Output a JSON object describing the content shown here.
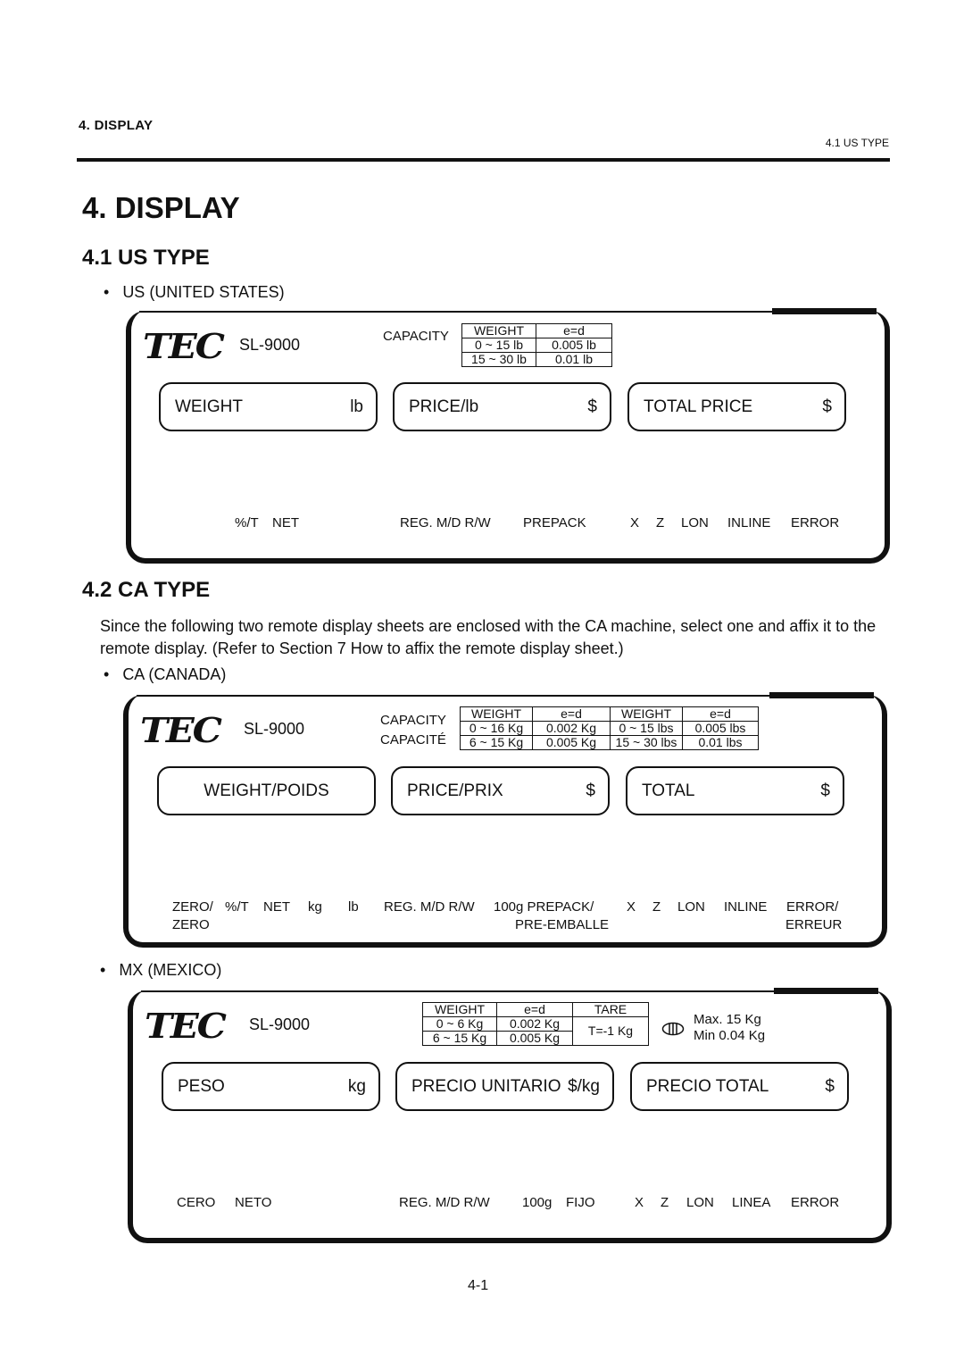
{
  "header": {
    "section": "4.  DISPLAY",
    "subsection": "4.1 US TYPE"
  },
  "title": "4. DISPLAY",
  "us": {
    "heading": "4.1  US TYPE",
    "bullet": "US (UNITED STATES)",
    "logo": "TEC",
    "model": "SL-9000",
    "capacity_label": "CAPACITY",
    "table": [
      [
        "WEIGHT",
        "e=d"
      ],
      [
        "0 ~ 15 lb",
        "0.005 lb"
      ],
      [
        "15 ~ 30 lb",
        "0.01 lb"
      ]
    ],
    "boxes": [
      {
        "label": "WEIGHT",
        "unit": "lb"
      },
      {
        "label": "PRICE/lb",
        "unit": "$"
      },
      {
        "label": "TOTAL PRICE",
        "unit": "$"
      }
    ],
    "indicators": [
      "%/T",
      "NET",
      "REG. M/D R/W",
      "PREPACK",
      "X",
      "Z",
      "LON",
      "INLINE",
      "ERROR"
    ]
  },
  "ca": {
    "heading": "4.2  CA TYPE",
    "paragraph": "Since the following two remote display sheets are enclosed with the CA machine, select one and affix it to the remote display.  (Refer to Section 7 How to affix the remote display sheet.)",
    "bullet": "CA (CANADA)",
    "logo": "TEC",
    "model": "SL-9000",
    "capacity_label": "CAPACITY",
    "capacity_label_fr": "CAPACITÉ",
    "table": [
      [
        "WEIGHT",
        "e=d",
        "WEIGHT",
        "e=d"
      ],
      [
        "0 ~ 16 Kg",
        "0.002 Kg",
        "0 ~ 15 lbs",
        "0.005 lbs"
      ],
      [
        "6 ~ 15 Kg",
        "0.005 Kg",
        "15 ~ 30 lbs",
        "0.01 lbs"
      ]
    ],
    "boxes": [
      {
        "label": "WEIGHT/POIDS",
        "unit": ""
      },
      {
        "label": "PRICE/PRIX",
        "unit": "$"
      },
      {
        "label": "TOTAL",
        "unit": "$"
      }
    ],
    "indicators": [
      "ZERO/",
      "%/T",
      "NET",
      "kg",
      "lb",
      "REG. M/D R/W",
      "100g PREPACK/",
      "X",
      "Z",
      "LON",
      "INLINE",
      "ERROR/"
    ],
    "indicators_line2": [
      "ZERO",
      "PRE-EMBALLE",
      "ERREUR"
    ]
  },
  "mx": {
    "bullet": "MX (MEXICO)",
    "logo": "TEC",
    "model": "SL-9000",
    "table": [
      [
        "WEIGHT",
        "e=d",
        "TARE"
      ],
      [
        "0 ~ 6 Kg",
        "0.002 Kg",
        "T=-1 Kg"
      ],
      [
        "6 ~ 15 Kg",
        "0.005 Kg"
      ]
    ],
    "max": "Max. 15 Kg",
    "min": "Min 0.04 Kg",
    "boxes": [
      {
        "label": "PESO",
        "unit": "kg"
      },
      {
        "label": "PRECIO UNITARIO",
        "unit": "$/kg"
      },
      {
        "label": "PRECIO TOTAL",
        "unit": "$"
      }
    ],
    "indicators": [
      "CERO",
      "NETO",
      "REG.  M/D  R/W",
      "100g",
      "FIJO",
      "X",
      "Z",
      "LON",
      "LINEA",
      "ERROR"
    ]
  },
  "page_number": "4-1"
}
